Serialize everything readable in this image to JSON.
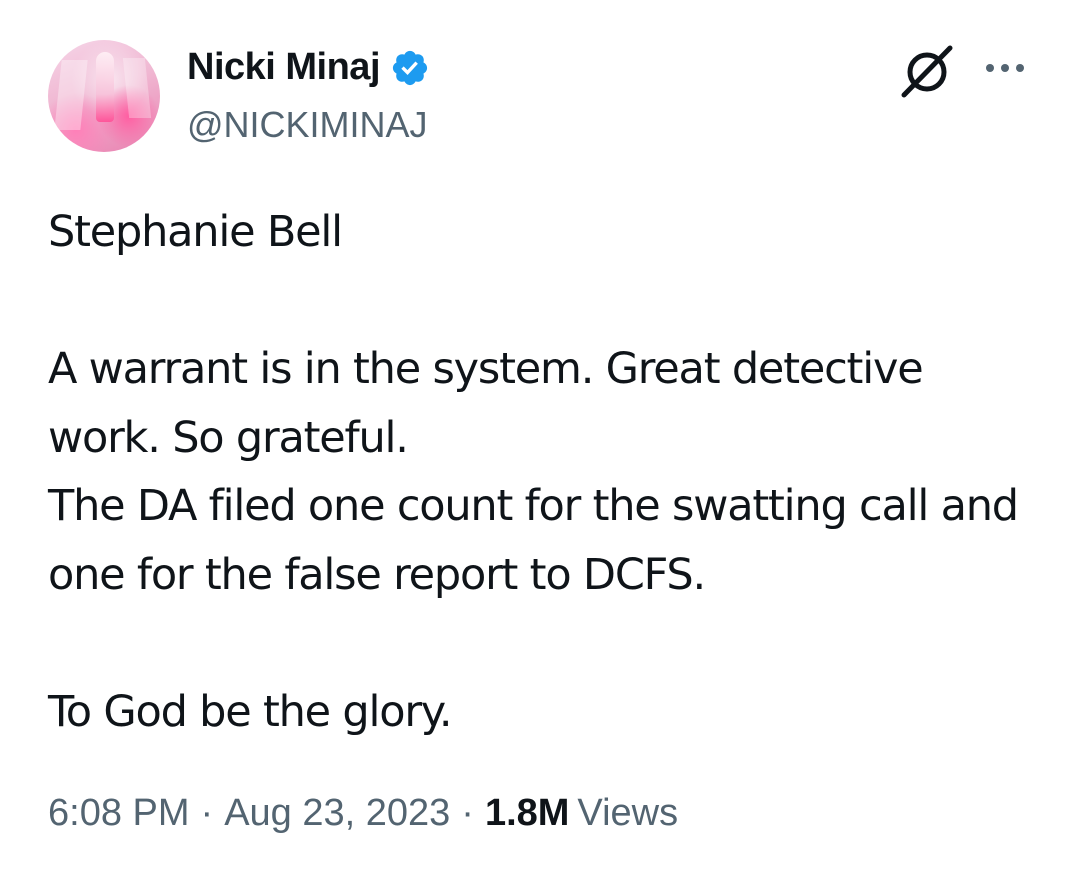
{
  "author": {
    "name": "Nicki Minaj",
    "handle": "@NICKIMINAJ",
    "verified_icon": "verified-badge-icon",
    "verified_color": "#1d9bf0"
  },
  "header_actions": {
    "grok_icon": "grok-icon",
    "more_icon": "more-dots-icon"
  },
  "tweet": {
    "text": "Stephanie Bell\n\nA warrant is in the system. Great detective work. So grateful.\nThe DA filed one count for the swatting call and one for the false report to DCFS.\n\nTo God be the glory."
  },
  "meta": {
    "time": "6:08 PM",
    "sep1": "·",
    "date": "Aug 23, 2023",
    "sep2": "·",
    "views_count": "1.8M",
    "views_label": "Views"
  },
  "colors": {
    "text": "#0f1419",
    "secondary": "#536471",
    "background": "#ffffff"
  }
}
